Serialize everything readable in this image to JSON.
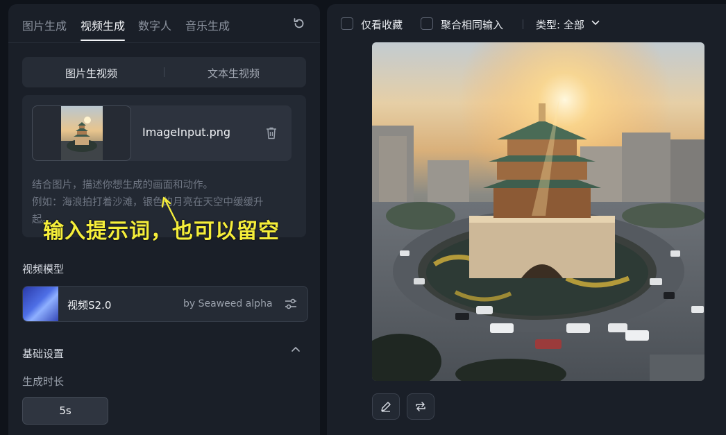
{
  "tabs": [
    {
      "label": "图片生成"
    },
    {
      "label": "视频生成",
      "active": true
    },
    {
      "label": "数字人"
    },
    {
      "label": "音乐生成"
    }
  ],
  "icons": {
    "refresh": "refresh-icon",
    "trash": "trash-icon",
    "settings": "sliders-icon",
    "collapse": "chevron-up-icon",
    "type_dropdown": "chevron-down-icon",
    "edit": "pencil-icon",
    "regenerate": "repeat-icon"
  },
  "mode": {
    "options": [
      {
        "label": "图片生视频",
        "selected": true
      },
      {
        "label": "文本生视频"
      }
    ]
  },
  "input": {
    "file_name": "ImageInput.png",
    "placeholder_line1": "结合图片，描述你想生成的画面和动作。",
    "placeholder_line2": "例如：海浪拍打着沙滩，银色的月亮在天空中缓缓升",
    "placeholder_line3": "起。",
    "annotation": "输入提示词，也可以留空"
  },
  "model": {
    "section_label": "视频模型",
    "name": "视频S2.0",
    "by": "by Seaweed alpha"
  },
  "basic": {
    "section_label": "基础设置",
    "duration_label": "生成时长",
    "duration_value": "5s"
  },
  "filters": {
    "favorites_only": "仅看收藏",
    "merge_same_input": "聚合相同输入",
    "type_label": "类型: 全部"
  },
  "colors": {
    "background": "#0f131a",
    "panel": "#1a1f28",
    "annotation": "#f5ee3a",
    "active_text": "#f2f4f7"
  }
}
